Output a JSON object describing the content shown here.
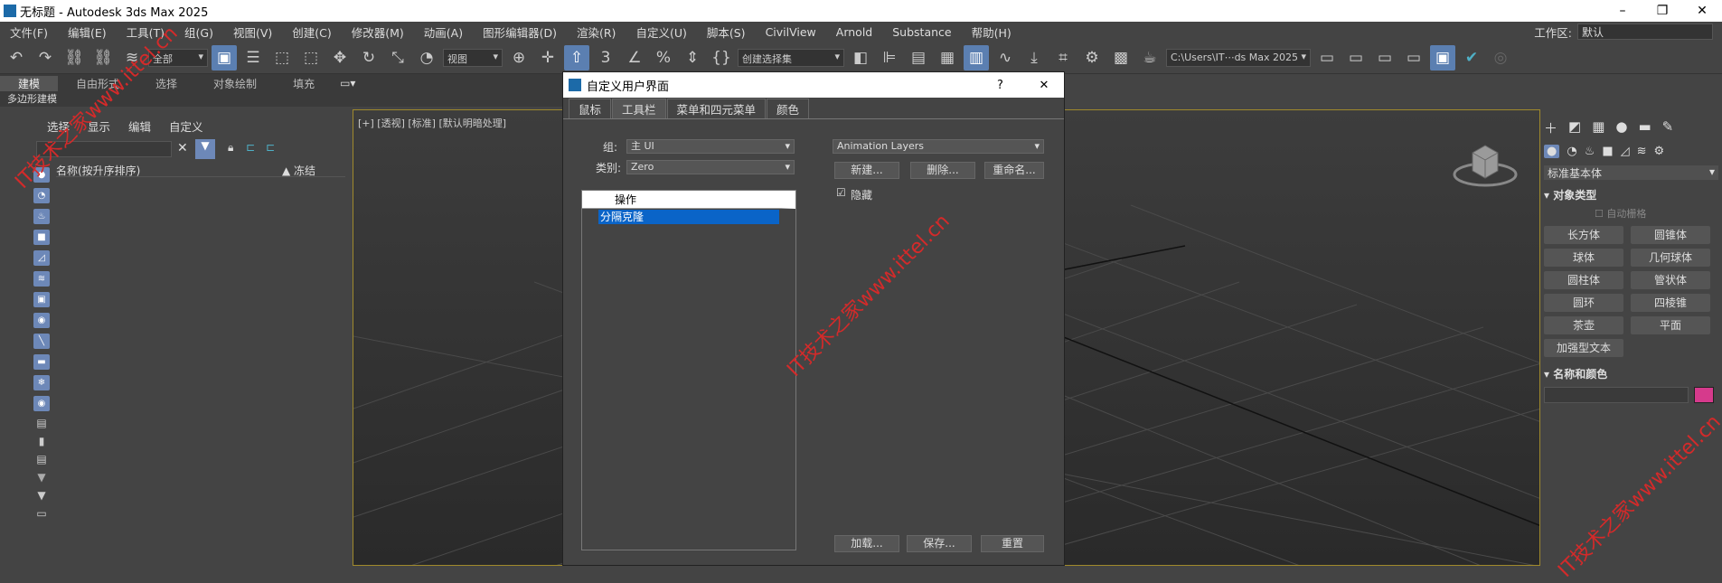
{
  "window": {
    "title": "无标题 - Autodesk 3ds Max 2025",
    "minimize": "–",
    "restore": "❐",
    "close": "✕"
  },
  "menu": [
    "文件(F)",
    "编辑(E)",
    "工具(T)",
    "组(G)",
    "视图(V)",
    "创建(C)",
    "修改器(M)",
    "动画(A)",
    "图形编辑器(D)",
    "渲染(R)",
    "自定义(U)",
    "脚本(S)",
    "CivilView",
    "Arnold",
    "Substance",
    "帮助(H)"
  ],
  "workspace": {
    "label": "工作区:",
    "value": "默认"
  },
  "toolbar": {
    "filter": "全部",
    "refcoord": "视图",
    "selset": "创建选择集",
    "path": "C:\\Users\\IT⋯ds Max 2025"
  },
  "ribbon": {
    "tabs": [
      "建模",
      "自由形式",
      "选择",
      "对象绘制",
      "填充"
    ],
    "sub": "多边形建模"
  },
  "scene_explorer": {
    "tabs": [
      "选择",
      "显示",
      "编辑",
      "自定义"
    ],
    "col_name": "名称(按升序排序)",
    "col_freeze": "▲ 冻结"
  },
  "viewport": {
    "label": "[+] [透视] [标准] [默认明暗处理]"
  },
  "dialog": {
    "title": "自定义用户界面",
    "help": "?",
    "close": "✕",
    "tabs": [
      "鼠标",
      "工具栏",
      "菜单和四元菜单",
      "颜色"
    ],
    "group_label": "组:",
    "group_value": "主 UI",
    "category_label": "类别:",
    "category_value": "Zero",
    "list_header": "操作",
    "list_item": "分隔克隆",
    "toolbar_value": "Animation Layers",
    "new_btn": "新建...",
    "delete_btn": "删除...",
    "rename_btn": "重命名...",
    "hide_label": "隐藏",
    "hide_checked": true,
    "load_btn": "加载...",
    "save_btn": "保存...",
    "reset_btn": "重置"
  },
  "command_panel": {
    "dropdown": "标准基本体",
    "section1": "对象类型",
    "autogrid": "自动栅格",
    "buttons": [
      "长方体",
      "圆锥体",
      "球体",
      "几何球体",
      "圆柱体",
      "管状体",
      "圆环",
      "四棱锥",
      "茶壶",
      "平面",
      "加强型文本"
    ],
    "section2": "名称和颜色",
    "swatch": "#d63a8c"
  },
  "watermark": [
    "IT技术之家www.ittel.cn",
    "IT技术之家www.ittel.cn",
    "IT技术之家www.ittel.cn"
  ]
}
